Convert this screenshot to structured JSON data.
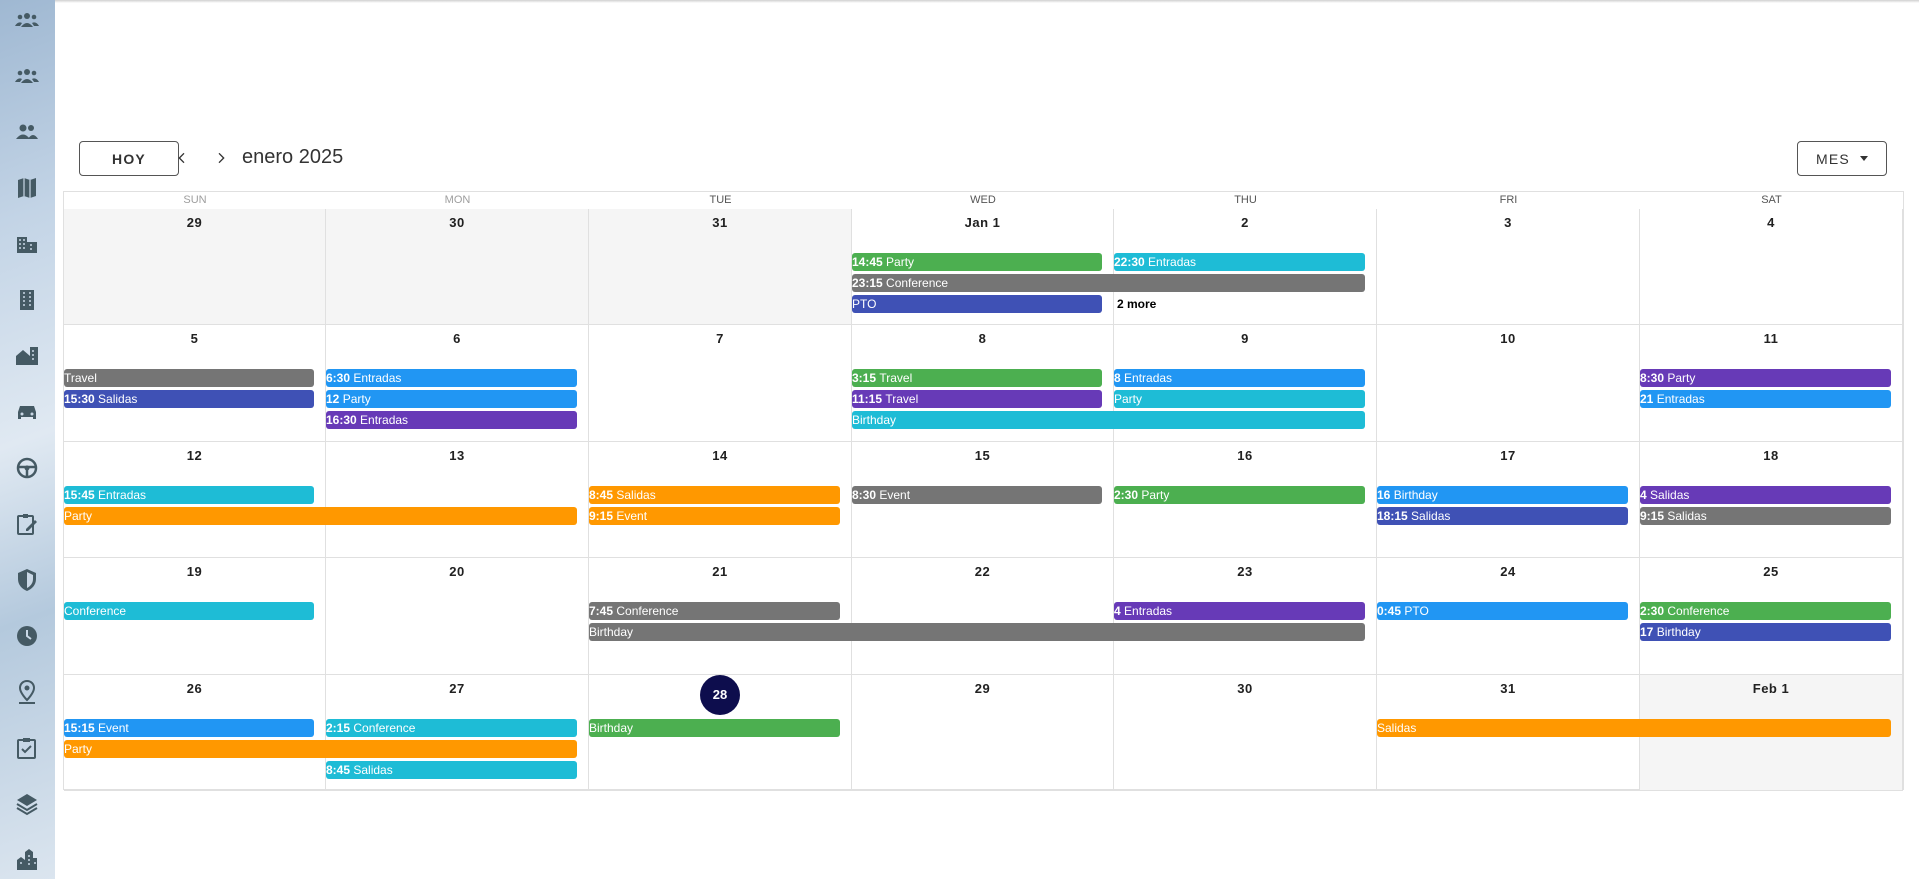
{
  "toolbar": {
    "today_label": "HOY",
    "month_title": "enero 2025",
    "view_label": "MES"
  },
  "sidebar_icons": [
    "groups-icon",
    "groups-icon",
    "people-icon",
    "map-icon",
    "business-icon",
    "apartment-icon",
    "home-work-icon",
    "car-icon",
    "steering-wheel-icon",
    "assignment-icon",
    "shield-icon",
    "clock-icon",
    "person-pin-icon",
    "checklist-icon",
    "layers-icon",
    "city-icon"
  ],
  "weekdays": [
    "SUN",
    "MON",
    "TUE",
    "WED",
    "THU",
    "FRI",
    "SAT"
  ],
  "colors": {
    "green": "#4caf50",
    "teal": "#1ebcd6",
    "grey": "#757575",
    "indigo": "#3f51b5",
    "blue": "#2196f3",
    "purple": "#673ab7",
    "orange": "#ff9800",
    "today": "#0d0d4d"
  },
  "weeks": [
    {
      "dates": [
        "29",
        "30",
        "31",
        "Jan 1",
        "2",
        "3",
        "4"
      ],
      "past": [
        true,
        true,
        true,
        false,
        false,
        false,
        false
      ],
      "events": [
        {
          "time": "14:45",
          "title": "Party",
          "start": 3,
          "span": 1,
          "row": 0,
          "color": "green"
        },
        {
          "time": "22:30",
          "title": "Entradas",
          "start": 4,
          "span": 1,
          "row": 0,
          "color": "teal"
        },
        {
          "time": "23:15",
          "title": "Conference",
          "start": 3,
          "span": 2,
          "row": 1,
          "color": "grey"
        },
        {
          "time": "",
          "title": "PTO",
          "start": 3,
          "span": 1,
          "row": 2,
          "color": "indigo"
        }
      ],
      "more": {
        "label": "2 more",
        "col": 4,
        "row": 2
      }
    },
    {
      "dates": [
        "5",
        "6",
        "7",
        "8",
        "9",
        "10",
        "11"
      ],
      "past": [
        false,
        false,
        false,
        false,
        false,
        false,
        false
      ],
      "events": [
        {
          "time": "",
          "title": "Travel",
          "start": 0,
          "span": 1,
          "row": 0,
          "color": "grey"
        },
        {
          "time": "15:30",
          "title": "Salidas",
          "start": 0,
          "span": 1,
          "row": 1,
          "color": "indigo"
        },
        {
          "time": "6:30",
          "title": "Entradas",
          "start": 1,
          "span": 1,
          "row": 0,
          "color": "blue"
        },
        {
          "time": "12",
          "title": "Party",
          "start": 1,
          "span": 1,
          "row": 1,
          "color": "blue"
        },
        {
          "time": "16:30",
          "title": "Entradas",
          "start": 1,
          "span": 1,
          "row": 2,
          "color": "purple"
        },
        {
          "time": "3:15",
          "title": "Travel",
          "start": 3,
          "span": 1,
          "row": 0,
          "color": "green"
        },
        {
          "time": "11:15",
          "title": "Travel",
          "start": 3,
          "span": 1,
          "row": 1,
          "color": "purple"
        },
        {
          "time": "",
          "title": "Birthday",
          "start": 3,
          "span": 2,
          "row": 2,
          "color": "teal"
        },
        {
          "time": "8",
          "title": "Entradas",
          "start": 4,
          "span": 1,
          "row": 0,
          "color": "blue"
        },
        {
          "time": "",
          "title": "Party",
          "start": 4,
          "span": 1,
          "row": 1,
          "color": "teal"
        },
        {
          "time": "8:30",
          "title": "Party",
          "start": 6,
          "span": 1,
          "row": 0,
          "color": "purple"
        },
        {
          "time": "21",
          "title": "Entradas",
          "start": 6,
          "span": 1,
          "row": 1,
          "color": "blue"
        }
      ]
    },
    {
      "dates": [
        "12",
        "13",
        "14",
        "15",
        "16",
        "17",
        "18"
      ],
      "past": [
        false,
        false,
        false,
        false,
        false,
        false,
        false
      ],
      "events": [
        {
          "time": "15:45",
          "title": "Entradas",
          "start": 0,
          "span": 1,
          "row": 0,
          "color": "teal"
        },
        {
          "time": "",
          "title": "Party",
          "start": 0,
          "span": 2,
          "row": 1,
          "color": "orange"
        },
        {
          "time": "8:45",
          "title": "Salidas",
          "start": 2,
          "span": 1,
          "row": 0,
          "color": "orange"
        },
        {
          "time": "9:15",
          "title": "Event",
          "start": 2,
          "span": 1,
          "row": 1,
          "color": "orange"
        },
        {
          "time": "8:30",
          "title": "Event",
          "start": 3,
          "span": 1,
          "row": 0,
          "color": "grey"
        },
        {
          "time": "2:30",
          "title": "Party",
          "start": 4,
          "span": 1,
          "row": 0,
          "color": "green"
        },
        {
          "time": "16",
          "title": "Birthday",
          "start": 5,
          "span": 1,
          "row": 0,
          "color": "blue"
        },
        {
          "time": "18:15",
          "title": "Salidas",
          "start": 5,
          "span": 1,
          "row": 1,
          "color": "indigo"
        },
        {
          "time": "4",
          "title": "Salidas",
          "start": 6,
          "span": 1,
          "row": 0,
          "color": "purple"
        },
        {
          "time": "9:15",
          "title": "Salidas",
          "start": 6,
          "span": 1,
          "row": 1,
          "color": "grey"
        }
      ]
    },
    {
      "dates": [
        "19",
        "20",
        "21",
        "22",
        "23",
        "24",
        "25"
      ],
      "past": [
        false,
        false,
        false,
        false,
        false,
        false,
        false
      ],
      "events": [
        {
          "time": "",
          "title": "Conference",
          "start": 0,
          "span": 1,
          "row": 0,
          "color": "teal"
        },
        {
          "time": "7:45",
          "title": "Conference",
          "start": 2,
          "span": 1,
          "row": 0,
          "color": "grey"
        },
        {
          "time": "",
          "title": "Birthday",
          "start": 2,
          "span": 3,
          "row": 1,
          "color": "grey"
        },
        {
          "time": "4",
          "title": "Entradas",
          "start": 4,
          "span": 1,
          "row": 0,
          "color": "purple"
        },
        {
          "time": "0:45",
          "title": "PTO",
          "start": 5,
          "span": 1,
          "row": 0,
          "color": "blue"
        },
        {
          "time": "2:30",
          "title": "Conference",
          "start": 6,
          "span": 1,
          "row": 0,
          "color": "green"
        },
        {
          "time": "17",
          "title": "Birthday",
          "start": 6,
          "span": 1,
          "row": 1,
          "color": "indigo"
        }
      ]
    },
    {
      "dates": [
        "26",
        "27",
        "28",
        "29",
        "30",
        "31",
        "Feb 1"
      ],
      "past": [
        false,
        false,
        false,
        false,
        false,
        false,
        true
      ],
      "today_index": 2,
      "events": [
        {
          "time": "15:15",
          "title": "Event",
          "start": 0,
          "span": 1,
          "row": 0,
          "color": "blue"
        },
        {
          "time": "",
          "title": "Party",
          "start": 0,
          "span": 2,
          "row": 1,
          "color": "orange"
        },
        {
          "time": "2:15",
          "title": "Conference",
          "start": 1,
          "span": 1,
          "row": 0,
          "color": "teal"
        },
        {
          "time": "8:45",
          "title": "Salidas",
          "start": 1,
          "span": 1,
          "row": 2,
          "color": "teal"
        },
        {
          "time": "",
          "title": "Birthday",
          "start": 2,
          "span": 1,
          "row": 0,
          "color": "green"
        },
        {
          "time": "",
          "title": "Salidas",
          "start": 5,
          "span": 2,
          "row": 0,
          "color": "orange"
        }
      ]
    }
  ]
}
